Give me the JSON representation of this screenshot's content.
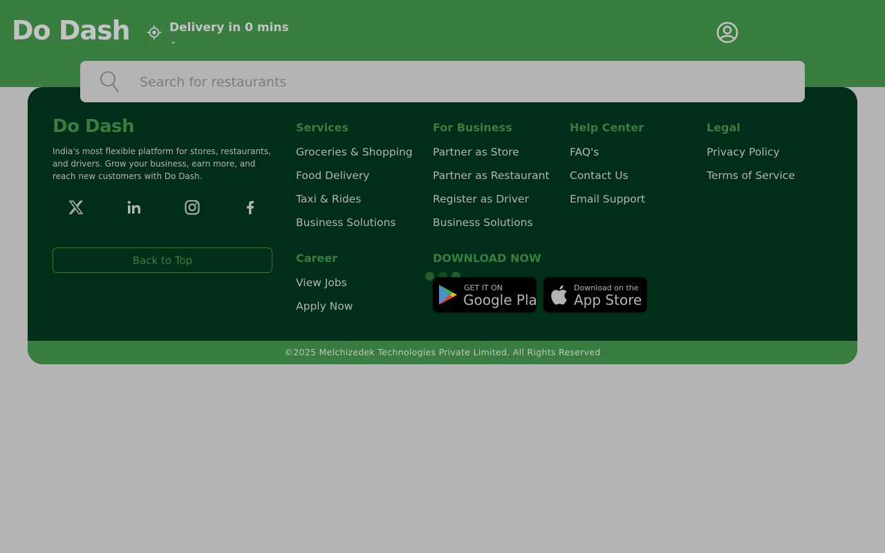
{
  "header": {
    "logo": "Do Dash",
    "delivery_text": "Delivery in 0 mins",
    "delivery_sub": "-",
    "icons": {
      "location": "location-target-icon",
      "profile": "user-circle-icon"
    }
  },
  "search": {
    "placeholder": "Search for restaurants",
    "icon": "search-icon"
  },
  "footer": {
    "logo": "Do Dash",
    "description": "India's most flexible platform for stores, restaurants, and drivers. Grow your business, earn more, and reach new customers with Do Dash.",
    "socials": [
      "x-icon",
      "linkedin-icon",
      "instagram-icon",
      "facebook-icon"
    ],
    "back_to_top": "Back to Top",
    "services": {
      "title": "Services",
      "items": [
        "Groceries & Shopping",
        "Food Delivery",
        "Taxi & Rides",
        "Business Solutions"
      ]
    },
    "business": {
      "title": "For Business",
      "items": [
        "Partner as Store",
        "Partner as Restaurant",
        "Register as Driver",
        "Business Solutions"
      ]
    },
    "help": {
      "title": "Help Center",
      "items": [
        "FAQ's",
        "Contact Us",
        "Email Support"
      ]
    },
    "legal": {
      "title": "Legal",
      "items": [
        "Privacy Policy",
        "Terms of Service"
      ]
    },
    "career": {
      "title": "Career",
      "items": [
        "View Jobs",
        "Apply Now"
      ]
    },
    "download": {
      "title": "DOWNLOAD NOW",
      "google_small": "GET IT ON",
      "google_big": "Google Play",
      "apple_small": "Download on the",
      "apple_big": "App Store"
    },
    "copyright": "©2025 Melchizedek Technologies Private Limited. All Rights Reserved"
  },
  "colors": {
    "header_green": "#3a7d41",
    "footer_dark": "#002e18",
    "overlay_gray": "#b4b4b4"
  }
}
